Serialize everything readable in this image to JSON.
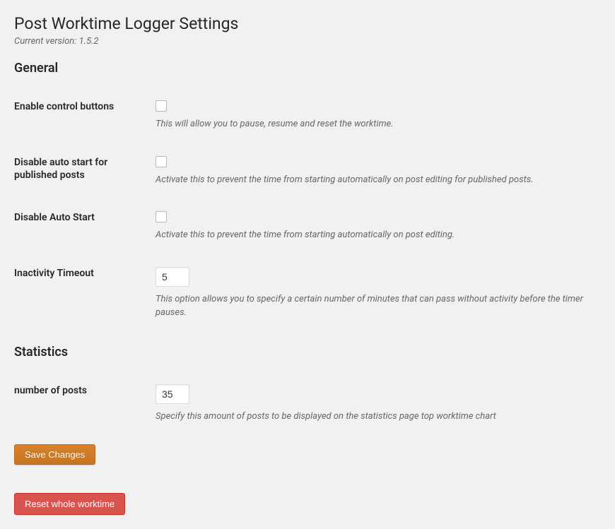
{
  "header": {
    "title": "Post Worktime Logger Settings",
    "version_label": "Current version: 1.5.2"
  },
  "sections": {
    "general": {
      "heading": "General",
      "enable_control_buttons": {
        "label": "Enable control buttons",
        "description": "This will allow you to pause, resume and reset the worktime.",
        "checked": false
      },
      "disable_auto_start_published": {
        "label": "Disable auto start for published posts",
        "description": "Activate this to prevent the time from starting automatically on post editing for published posts.",
        "checked": false
      },
      "disable_auto_start": {
        "label": "Disable Auto Start",
        "description": "Activate this to prevent the time from starting automatically on post editing.",
        "checked": false
      },
      "inactivity_timeout": {
        "label": "Inactivity Timeout",
        "value": "5",
        "description": "This option allows you to specify a certain number of minutes that can pass without activity before the timer pauses."
      }
    },
    "statistics": {
      "heading": "Statistics",
      "number_of_posts": {
        "label": "number of posts",
        "value": "35",
        "description": "Specify this amount of posts to be displayed on the statistics page top worktime chart"
      }
    }
  },
  "buttons": {
    "save": "Save Changes",
    "reset": "Reset whole worktime"
  }
}
